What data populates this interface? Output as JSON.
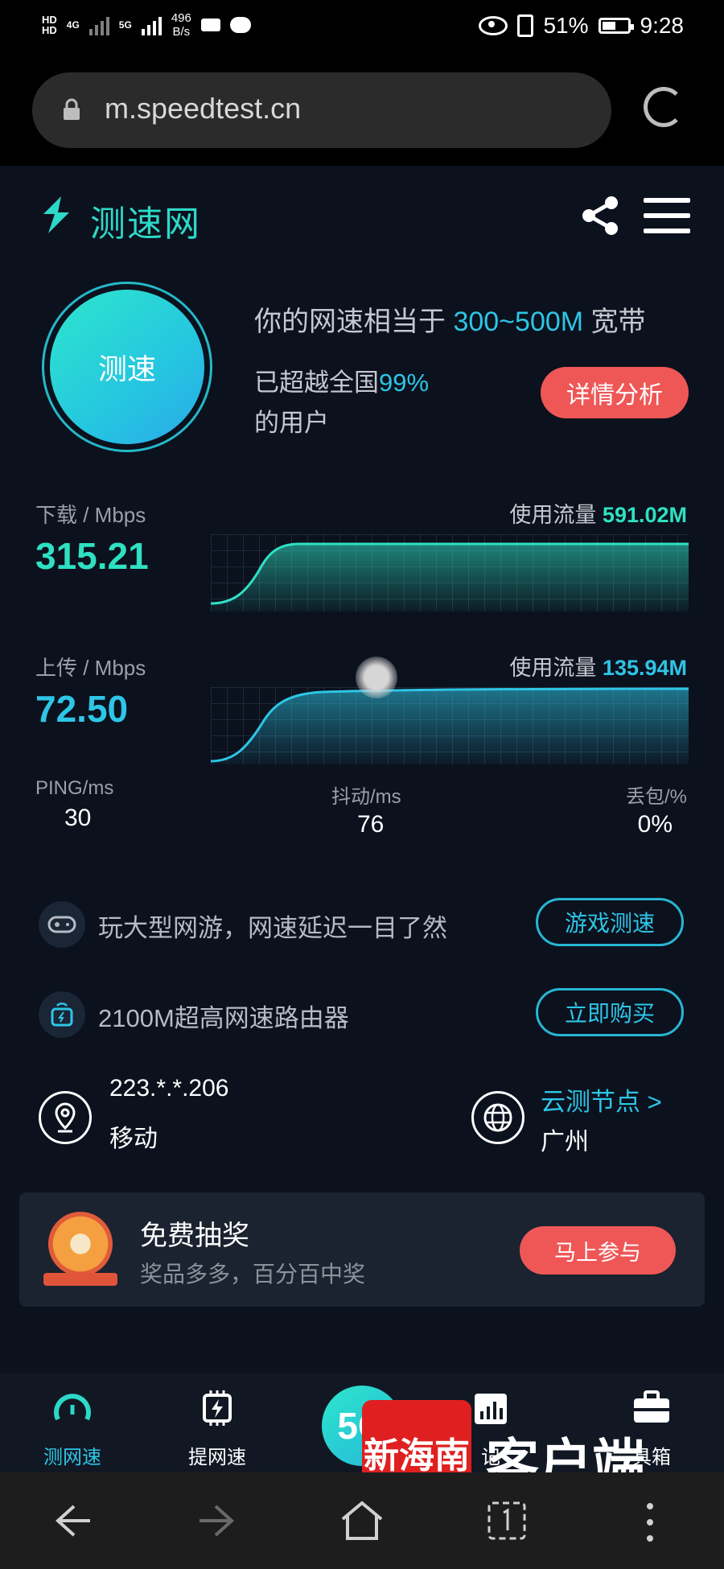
{
  "status_bar": {
    "hd1": "HD",
    "hd2": "HD",
    "net_4g": "4G",
    "net_5g": "5G",
    "speed_value": "496",
    "speed_unit": "B/s",
    "battery": "51%",
    "time": "9:28"
  },
  "browser": {
    "url": "m.speedtest.cn"
  },
  "header": {
    "logo_text": "测速网"
  },
  "summary": {
    "gauge_label": "测速",
    "equivalent_prefix": "你的网速相当于 ",
    "equivalent_value": "300~500M",
    "equivalent_suffix": " 宽带",
    "beat_prefix": "已超越全国",
    "beat_percent": "99%",
    "beat_suffix": "的用户",
    "detail_button": "详情分析"
  },
  "download": {
    "label": "下载 / Mbps",
    "value": "315.21",
    "usage_label": "使用流量 ",
    "usage_value": "591.02M"
  },
  "upload": {
    "label": "上传 / Mbps",
    "value": "72.50",
    "usage_label": "使用流量 ",
    "usage_value": "135.94M"
  },
  "metrics": {
    "ping_label": "PING/ms",
    "ping_value": "30",
    "jitter_label": "抖动/ms",
    "jitter_value": "76",
    "loss_label": "丢包/%",
    "loss_value": "0%"
  },
  "promos": [
    {
      "text": "玩大型网游，网速延迟一目了然",
      "button": "游戏测速",
      "icon": "gamepad-icon"
    },
    {
      "text": "2100M超高网速路由器",
      "button": "立即购买",
      "icon": "router-icon"
    }
  ],
  "network": {
    "ip": "223.*.*.206",
    "carrier": "移动",
    "node_label": "云测节点 >",
    "node_city": "广州"
  },
  "lottery": {
    "title": "免费抽奖",
    "subtitle": "奖品多多，百分百中奖",
    "button": "马上参与"
  },
  "bottom_nav": {
    "items": [
      {
        "label": "测网速",
        "icon": "speedometer-icon"
      },
      {
        "label": "提网速",
        "icon": "chip-icon"
      },
      {
        "label": "5G",
        "icon": "5g-icon"
      },
      {
        "label": "记",
        "icon": "calendar-chart-icon"
      },
      {
        "label": "具箱",
        "icon": "toolbox-icon"
      }
    ]
  },
  "watermark": {
    "logo": "新海南",
    "text": "客户端"
  },
  "colors": {
    "accent": "#2ec5e6",
    "download": "#2fe0c3",
    "red_button": "#ef5757",
    "background": "#0b111d"
  }
}
